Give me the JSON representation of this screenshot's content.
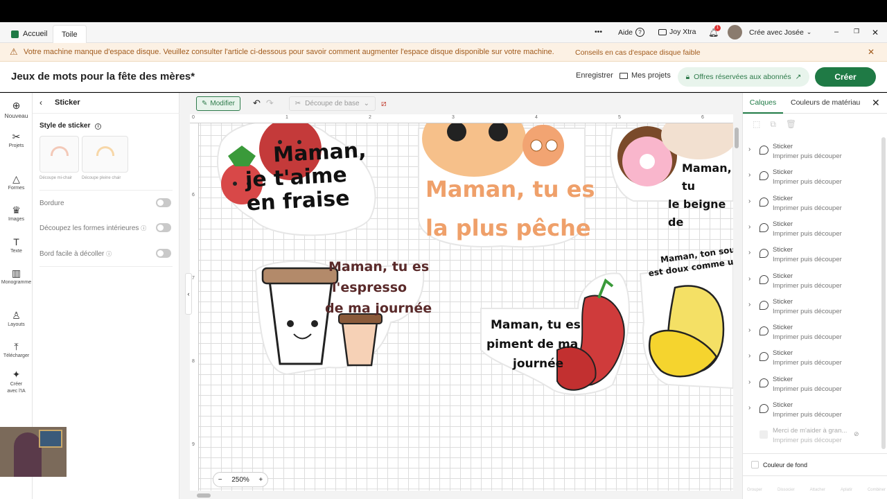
{
  "window": {
    "tabs": [
      {
        "label": "Accueil",
        "icon": "home-icon"
      },
      {
        "label": "Toile"
      }
    ],
    "more_label": "•••",
    "help_label": "Aide",
    "joy_label": "Joy Xtra",
    "notification_count": "1",
    "profile_label": "Crée avec Josée"
  },
  "banner": {
    "message": "Votre machine manque d'espace disque. Veuillez consulter l'article ci-dessous pour savoir comment augmenter l'espace disque disponible sur votre machine.",
    "link": "Conseils en cas d'espace disque faible"
  },
  "project": {
    "title": "Jeux de mots pour la fête des mères*",
    "save_label": "Enregistrer",
    "my_projects_label": "Mes projets",
    "offers_label": "Offres réservées aux abonnés",
    "create_label": "Créer"
  },
  "rail": [
    {
      "label": "Nouveau",
      "icon": "plus-circle-icon"
    },
    {
      "label": "Projets",
      "icon": "projects-icon"
    },
    {
      "label": "Formes",
      "icon": "shapes-icon"
    },
    {
      "label": "Images",
      "icon": "images-icon"
    },
    {
      "label": "Texte",
      "icon": "text-icon"
    },
    {
      "label": "Monogramme",
      "icon": "monogram-icon"
    },
    {
      "label": "Layouts",
      "icon": "layouts-icon"
    },
    {
      "label": "Télécharger",
      "icon": "upload-icon"
    },
    {
      "label": "Créer avec l'IA",
      "icon": "sparkle-icon"
    }
  ],
  "left_panel": {
    "title": "Sticker",
    "style_label": "Style de sticker",
    "style_options": [
      "Découpe mi-chair",
      "Découpe pleine chair"
    ],
    "border_label": "Bordure",
    "inner_label": "Découpez les formes intérieures",
    "easy_peel_label": "Bord facile à décoller"
  },
  "canvas": {
    "modify_label": "Modifier",
    "cut_type_label": "Découpe de base",
    "zoom_label": "250%",
    "ruler_top": [
      "0",
      "1",
      "2",
      "3",
      "4",
      "5",
      "6"
    ],
    "ruler_left": [
      "6",
      "7",
      "8",
      "9"
    ],
    "stickers": {
      "strawberry": [
        "Maman,",
        "je t'aime",
        "en fraise"
      ],
      "peach": [
        "Maman, tu es",
        "la plus pêche"
      ],
      "donut": [
        "Maman, tu",
        "le beigne de"
      ],
      "coffee": [
        "Maman, tu es",
        "l'espresso",
        "de ma journée"
      ],
      "pepper": [
        "Maman, tu es",
        "piment de ma",
        "journée"
      ],
      "banana": [
        "Maman, ton sou",
        "est doux comme une"
      ]
    }
  },
  "right_panel": {
    "tab_layers": "Calques",
    "tab_colors": "Couleurs de matériau",
    "layers": [
      {
        "name": "Sticker",
        "sub": "Imprimer puis découper"
      },
      {
        "name": "Sticker",
        "sub": "Imprimer puis découper"
      },
      {
        "name": "Sticker",
        "sub": "Imprimer puis découper"
      },
      {
        "name": "Sticker",
        "sub": "Imprimer puis découper"
      },
      {
        "name": "Sticker",
        "sub": "Imprimer puis découper"
      },
      {
        "name": "Sticker",
        "sub": "Imprimer puis découper"
      },
      {
        "name": "Sticker",
        "sub": "Imprimer puis découper"
      },
      {
        "name": "Sticker",
        "sub": "Imprimer puis découper"
      },
      {
        "name": "Sticker",
        "sub": "Imprimer puis découper"
      },
      {
        "name": "Sticker",
        "sub": "Imprimer puis découper"
      },
      {
        "name": "Sticker",
        "sub": "Imprimer puis découper"
      }
    ],
    "hidden_layer": {
      "name": "Merci de m'aider à gran...",
      "sub": "Imprimer puis découper"
    },
    "bg_color_label": "Couleur de fond",
    "bottom_actions": [
      "Grouper",
      "Dissocier",
      "Attacher",
      "Aplatir",
      "Combiner"
    ]
  },
  "colors": {
    "accent": "#1f7a45",
    "warning": "#a05a1c",
    "banner_bg": "#fcf1e4"
  }
}
